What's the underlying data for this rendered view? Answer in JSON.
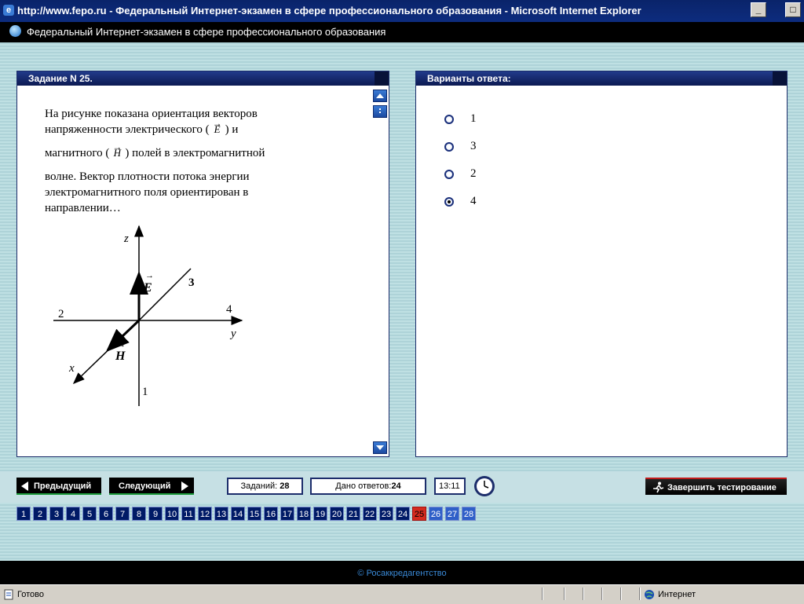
{
  "window": {
    "title": "http://www.fepo.ru - Федеральный Интернет-экзамен в сфере профессионального образования - Microsoft Internet Explorer"
  },
  "app": {
    "header": "Федеральный Интернет-экзамен в сфере профессионального образования"
  },
  "task": {
    "header": "Задание N 25.",
    "text_line1": "На рисунке показана ориентация векторов",
    "text_line2a": "напряженности электрического (",
    "vecE": "E",
    "text_line2b": ") и",
    "text_line3a": "магнитного (",
    "vecH": "H",
    "text_line3b": ") полей в электромагнитной",
    "text_line4": "волне. Вектор плотности потока энергии",
    "text_line5": "электромагнитного поля ориентирован в",
    "text_line6": "направлении…",
    "figure": {
      "z_axis": "z",
      "y_axis": "y",
      "x_axis": "x",
      "E_label": "E",
      "H_label": "H",
      "d1": "1",
      "d2": "2",
      "d3": "3",
      "d4": "4"
    }
  },
  "answers": {
    "header": "Варианты ответа:",
    "options": [
      {
        "label": "1",
        "selected": false
      },
      {
        "label": "3",
        "selected": false
      },
      {
        "label": "2",
        "selected": false
      },
      {
        "label": "4",
        "selected": true
      }
    ]
  },
  "nav": {
    "prev": "Предыдущий",
    "next": "Следующий",
    "tasks_label": "Заданий:",
    "tasks_count": "28",
    "answered_label": "Дано ответов:",
    "answered_count": "24",
    "time": "13:11",
    "finish": "Завершить тестирование"
  },
  "question_numbers": [
    "1",
    "2",
    "3",
    "4",
    "5",
    "6",
    "7",
    "8",
    "9",
    "10",
    "11",
    "12",
    "13",
    "14",
    "15",
    "16",
    "17",
    "18",
    "19",
    "20",
    "21",
    "22",
    "23",
    "24",
    "25",
    "26",
    "27",
    "28"
  ],
  "current_question": "25",
  "footer": {
    "copyright": "© Росаккредагентство"
  },
  "statusbar": {
    "status": "Готово",
    "zone": "Интернет"
  },
  "colors": {
    "titlebar": "#0a246a",
    "panel_header": "#213a8a",
    "current_question": "#d42b1e",
    "background_stripe": "#aed3d8"
  }
}
